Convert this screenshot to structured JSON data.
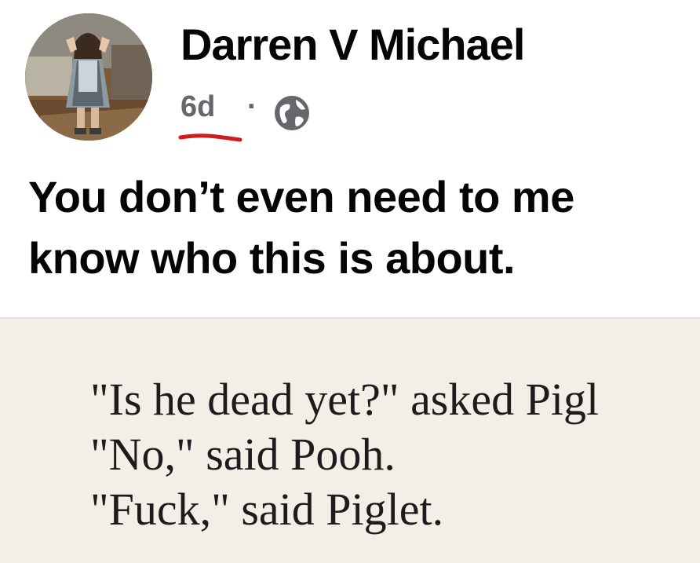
{
  "post": {
    "author": "Darren V Michael",
    "timestamp": "6d",
    "separator": "·",
    "audience_icon": "globe-icon",
    "text_lines": [
      "You don’t even need to me",
      "know who this is about."
    ]
  },
  "quote_image": {
    "lines": [
      "\"Is he dead yet?\" asked Pigl",
      "\"No,\" said Pooh.",
      "\"Fuck,\" said Piglet."
    ]
  },
  "colors": {
    "name": "#050505",
    "meta": "#65676b",
    "underline_annotation": "#d21a1a",
    "image_background": "#f3efe6"
  }
}
